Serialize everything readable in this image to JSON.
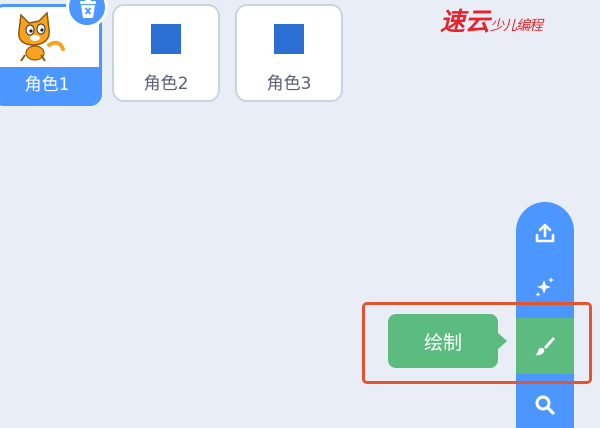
{
  "sprites": [
    {
      "label": "角色1",
      "selected": true,
      "thumbnail": "cat-sprite"
    },
    {
      "label": "角色2",
      "selected": false,
      "thumbnail": "blue-square"
    },
    {
      "label": "角色3",
      "selected": false,
      "thumbnail": "blue-square"
    }
  ],
  "brand": {
    "text_large": "速云",
    "text_small": "少儿编程"
  },
  "sprite_menu": {
    "buttons": [
      {
        "icon": "upload-icon"
      },
      {
        "icon": "surprise-sparkle-icon"
      },
      {
        "icon": "paint-brush-icon",
        "active": true
      },
      {
        "icon": "search-icon"
      }
    ],
    "tooltip_label": "绘制"
  },
  "colors": {
    "background": "#e9eef6",
    "accent_blue": "#4c97ff",
    "active_green": "#5cbb7e",
    "highlight_orange": "#e2552f",
    "brand_red": "#e8212b",
    "thumbnail_blue": "#2a6fd1"
  }
}
